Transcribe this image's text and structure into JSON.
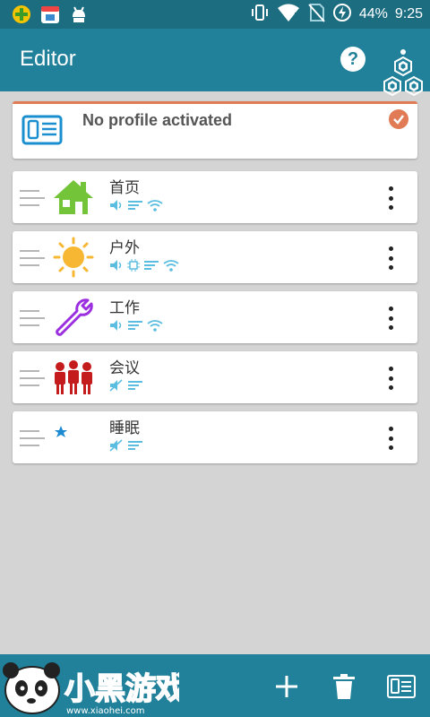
{
  "status_bar": {
    "battery": "44%",
    "time": "9:25"
  },
  "app_bar": {
    "title": "Editor",
    "help_label": "?"
  },
  "activated_profile": {
    "text": "No profile activated"
  },
  "profiles": [
    {
      "name": "首页",
      "icon": "home-icon",
      "status_icons": [
        "volume-icon",
        "vibrate-lines-icon",
        "wifi-icon"
      ]
    },
    {
      "name": "户外",
      "icon": "sun-icon",
      "status_icons": [
        "volume-icon",
        "cpu-icon",
        "vibrate-lines-icon",
        "wifi-icon"
      ]
    },
    {
      "name": "工作",
      "icon": "wrench-icon",
      "status_icons": [
        "volume-icon",
        "vibrate-lines-icon",
        "wifi-icon"
      ]
    },
    {
      "name": "会议",
      "icon": "people-icon",
      "status_icons": [
        "mute-icon",
        "vibrate-lines-icon"
      ]
    },
    {
      "name": "睡眠",
      "icon": "moon-star-icon",
      "status_icons": [
        "mute-icon",
        "vibrate-lines-icon"
      ]
    }
  ],
  "colors": {
    "status_bar": "#1d6d80",
    "app_bar": "#22819a",
    "background": "#d4d4d4",
    "accent_orange": "#e07b55",
    "status_icon_blue": "#5bbde0"
  },
  "watermark": {
    "brand": "小黑游戏",
    "url": "www.xiaohei.com"
  }
}
